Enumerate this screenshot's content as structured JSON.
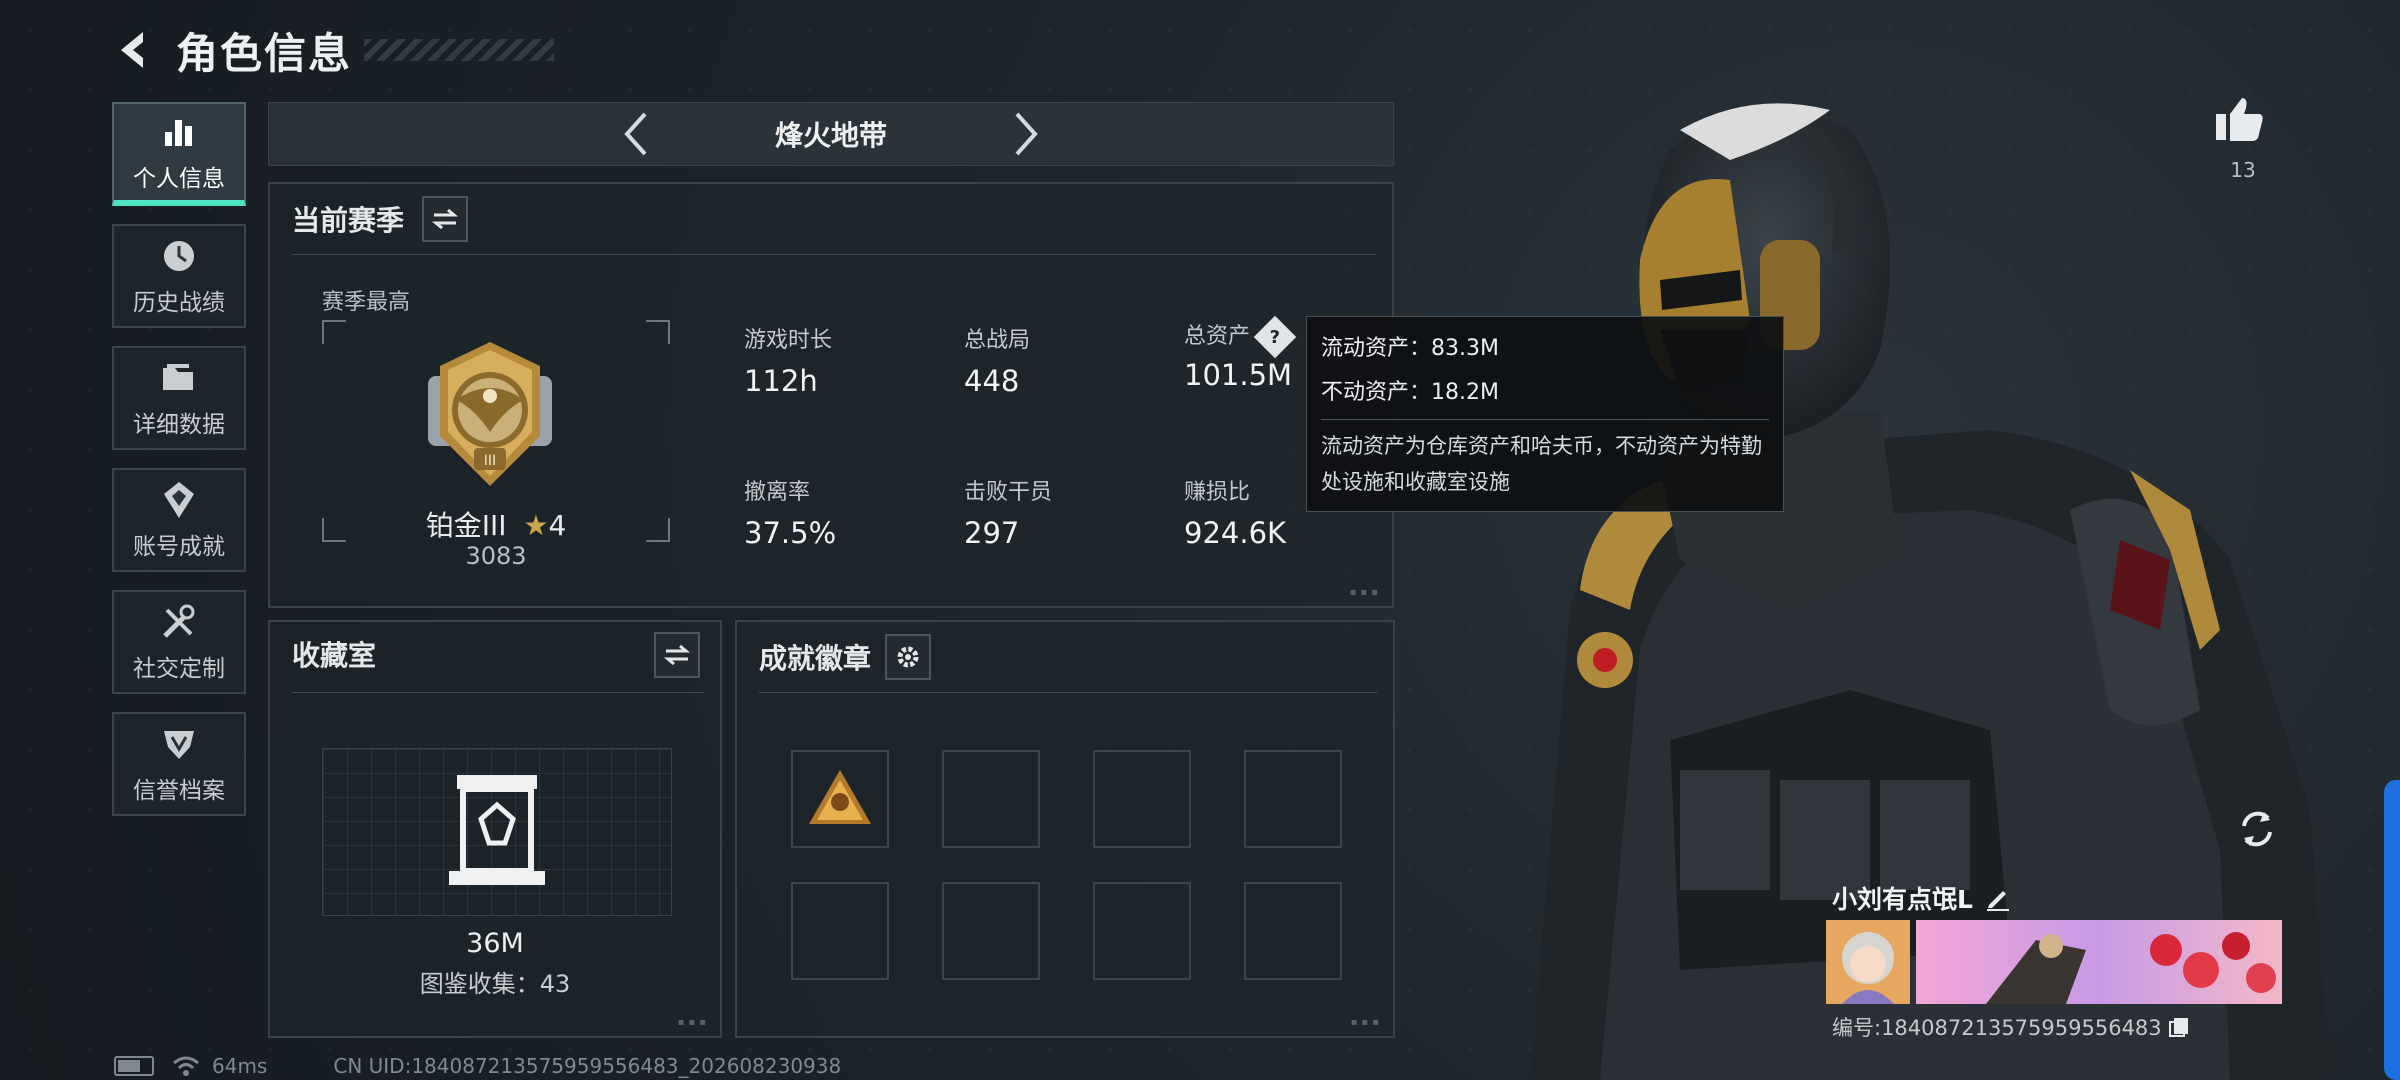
{
  "header": {
    "title": "角色信息"
  },
  "nav": {
    "items": [
      {
        "label": "个人信息",
        "icon": "bar-chart-icon",
        "active": true
      },
      {
        "label": "历史战绩",
        "icon": "history-clock-icon"
      },
      {
        "label": "详细数据",
        "icon": "folder-icon"
      },
      {
        "label": "账号成就",
        "icon": "achievement-badge-icon"
      },
      {
        "label": "社交定制",
        "icon": "tools-icon"
      },
      {
        "label": "信誉档案",
        "icon": "reputation-shield-icon"
      }
    ]
  },
  "mode": {
    "name": "烽火地带"
  },
  "season": {
    "title": "当前赛季",
    "best_label": "赛季最高",
    "rank_name": "铂金III",
    "rank_stars": "4",
    "rank_score": "3083",
    "stats": {
      "play_time": {
        "label": "游戏时长",
        "value": "112h"
      },
      "total_matches": {
        "label": "总战局",
        "value": "448"
      },
      "total_assets": {
        "label": "总资产",
        "value": "101.5M"
      },
      "extract_rate": {
        "label": "撤离率",
        "value": "37.5%"
      },
      "kills": {
        "label": "击败干员",
        "value": "297"
      },
      "profit_ratio": {
        "label": "赚损比",
        "value": "924.6K"
      }
    }
  },
  "tooltip": {
    "liquid": "流动资产：83.3M",
    "fixed": "不动资产：18.2M",
    "note": "流动资产为仓库资产和哈夫币，不动资产为特勤处设施和收藏室设施"
  },
  "collection": {
    "title": "收藏室",
    "value": "36M",
    "count": "图鉴收集：43"
  },
  "badges": {
    "title": "成就徽章"
  },
  "profile": {
    "likes": "13",
    "player_name": "小刘有点氓L",
    "player_id": "编号:184087213575959556483"
  },
  "status_bar": {
    "ping": "64ms",
    "uid": "CN UID:184087213575959556483_202608230938"
  },
  "colors": {
    "accent": "#4fe3c4",
    "gold": "#c99a3e",
    "panel_border": "#39434a"
  }
}
